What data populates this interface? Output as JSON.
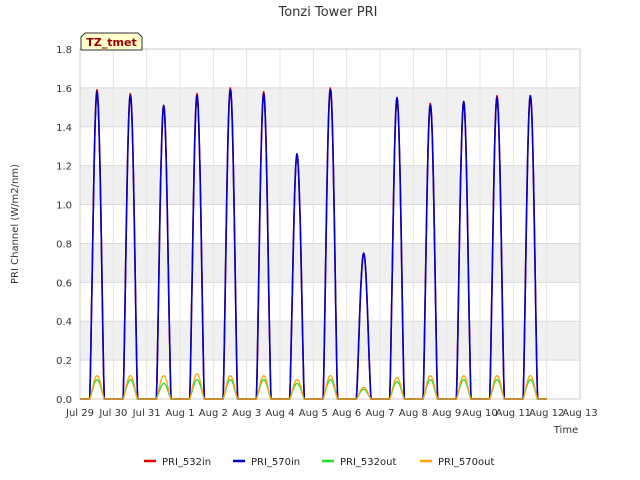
{
  "chart_data": {
    "type": "line",
    "title": "Tonzi Tower PRI",
    "xlabel": "Time",
    "ylabel": "PRI Channel (W/m2/nm)",
    "ylim": [
      0.0,
      1.8
    ],
    "xlim": [
      "2000-07-29",
      "2000-08-13"
    ],
    "x_ticks": [
      "Jul 29",
      "Jul 30",
      "Jul 31",
      "Aug 1",
      "Aug 2",
      "Aug 3",
      "Aug 4",
      "Aug 5",
      "Aug 6",
      "Aug 7",
      "Aug 8",
      "Aug 9",
      "Aug 10",
      "Aug 11",
      "Aug 12",
      "Aug 13"
    ],
    "y_ticks": [
      "0.0",
      "0.2",
      "0.4",
      "0.6",
      "0.8",
      "1.0",
      "1.2",
      "1.4",
      "1.6",
      "1.8"
    ],
    "grid": true,
    "shaded_bands": true,
    "legend_position": "bottom",
    "tag": "TZ_tmet",
    "series": [
      {
        "name": "PRI_532in",
        "color": "#dd0000",
        "daily_peak": [
          1.59,
          1.57,
          1.51,
          1.57,
          1.6,
          1.58,
          1.26,
          1.6,
          0.75,
          1.55,
          1.52,
          1.53,
          1.56,
          1.56
        ]
      },
      {
        "name": "PRI_570in",
        "color": "#0000cc",
        "daily_peak": [
          1.58,
          1.56,
          1.51,
          1.56,
          1.59,
          1.57,
          1.26,
          1.59,
          0.75,
          1.55,
          1.51,
          1.53,
          1.55,
          1.56
        ]
      },
      {
        "name": "PRI_532out",
        "color": "#22dd22",
        "daily_peak": [
          0.1,
          0.1,
          0.08,
          0.1,
          0.1,
          0.1,
          0.08,
          0.1,
          0.05,
          0.09,
          0.1,
          0.1,
          0.1,
          0.1
        ]
      },
      {
        "name": "PRI_570out",
        "color": "#ffa500",
        "daily_peak": [
          0.12,
          0.12,
          0.12,
          0.13,
          0.12,
          0.12,
          0.1,
          0.12,
          0.06,
          0.11,
          0.12,
          0.12,
          0.12,
          0.12
        ]
      }
    ],
    "day_starts": [
      "2000-07-29",
      "2000-07-30",
      "2000-07-31",
      "2000-08-01",
      "2000-08-02",
      "2000-08-03",
      "2000-08-04",
      "2000-08-05",
      "2000-08-06",
      "2000-08-07",
      "2000-08-08",
      "2000-08-09",
      "2000-08-10",
      "2000-08-11",
      "2000-08-12"
    ],
    "data_days": [
      "2000-07-29",
      "2000-07-30",
      "2000-07-31",
      "2000-08-01",
      "2000-08-02",
      "2000-08-03",
      "2000-08-04",
      "2000-08-05",
      "2000-08-06",
      "2000-08-07",
      "2000-08-08",
      "2000-08-09",
      "2000-08-10",
      "2000-08-11"
    ]
  }
}
